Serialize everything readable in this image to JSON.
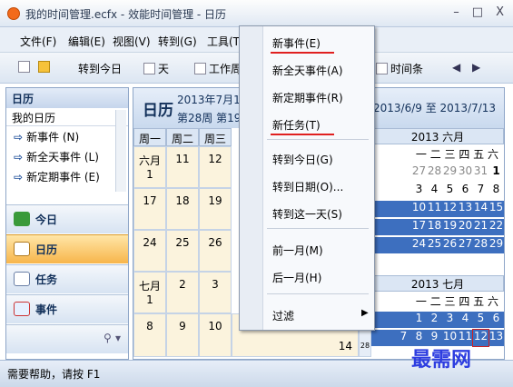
{
  "window": {
    "title": "我的时间管理.ecfx - 效能时间管理 - 日历",
    "min": "–",
    "max": "□",
    "close": "X"
  },
  "menu": [
    "文件(F)",
    "编辑(E)",
    "视图(V)",
    "转到(G)",
    "工具(T)"
  ],
  "toolbar": {
    "goto_today": "转到今日",
    "day": "天",
    "workweek": "工作周",
    "timeline": "时间条"
  },
  "sidebar": {
    "header": "日历",
    "subheader": "我的日历",
    "items": [
      "新事件 (N)",
      "新全天事件 (L)",
      "新定期事件 (E)"
    ],
    "nav": [
      {
        "label": "今日",
        "icon": "today-icon"
      },
      {
        "label": "日历",
        "icon": "calendar-icon"
      },
      {
        "label": "任务",
        "icon": "task-icon"
      },
      {
        "label": "事件",
        "icon": "event-icon"
      }
    ]
  },
  "calendar": {
    "title": "日历",
    "date": "2013年7月1",
    "week": "第28周 第19",
    "range": "2013/6/9 至 2013/7/13",
    "weekday_headers": [
      "周一",
      "周二",
      "周三"
    ],
    "weeks": [
      [
        "六月 1",
        "11",
        "12"
      ],
      [
        "17",
        "18",
        "19"
      ],
      [
        "24",
        "25",
        "26"
      ],
      [
        "七月 1",
        "2",
        "3"
      ],
      [
        "8",
        "9",
        "10"
      ]
    ],
    "extra_day": "14",
    "extra_num": "28"
  },
  "mini_june": {
    "header": "2013 六月",
    "dow": "一 二 三 四 五 六",
    "rows": [
      [
        "27",
        "28",
        "29",
        "30",
        "31",
        "1"
      ],
      [
        "3",
        "4",
        "5",
        "6",
        "7",
        "8"
      ],
      [
        "10",
        "11",
        "12",
        "13",
        "14",
        "15"
      ],
      [
        "17",
        "18",
        "19",
        "20",
        "21",
        "22"
      ],
      [
        "24",
        "25",
        "26",
        "27",
        "28",
        "29"
      ]
    ]
  },
  "mini_july": {
    "header": "2013 七月",
    "dow": "一 二 三 四 五 六",
    "rows": [
      [
        "1",
        "2",
        "3",
        "4",
        "5",
        "6"
      ],
      [
        "7",
        "8",
        "9",
        "10",
        "11",
        "12",
        "13"
      ]
    ]
  },
  "context_menu": {
    "items": [
      "新事件(E)",
      "新全天事件(A)",
      "新定期事件(R)",
      "新任务(T)",
      "转到今日(G)",
      "转到日期(O)...",
      "转到这一天(S)",
      "前一月(M)",
      "后一月(H)",
      "过滤"
    ]
  },
  "status": {
    "text": "需要帮助，请按 F1"
  },
  "watermark": "最需网",
  "colors": {
    "accent": "#3d6fbf",
    "highlight": "#e02020",
    "cell": "#fbf3dd"
  }
}
